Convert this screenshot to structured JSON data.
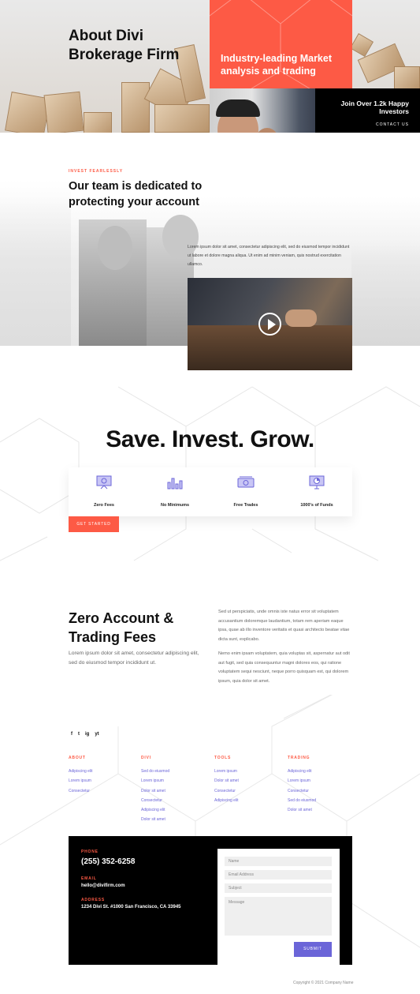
{
  "hero": {
    "title": "About Divi Brokerage Firm",
    "orange_text": "Industry-leading Market analysis and trading",
    "join_text": "Join Over 1.2k Happy Investors",
    "contact_label": "CONTACT US"
  },
  "team": {
    "kicker": "INVEST FEARLESSLY",
    "heading": "Our team is dedicated to protecting your account",
    "body": "Lorem ipsum dolor sit amet, consectetur adipiscing elit, sed do eiusmod tempor incididunt ut labore et dolore magna aliqua. Ut enim ad minim veniam, quis nostrud exercitation ullamco."
  },
  "grow": {
    "title": "Save. Invest. Grow.",
    "features": [
      {
        "label": "Zero Fees",
        "icon": "presentation-board-icon"
      },
      {
        "label": "No Minimums",
        "icon": "bar-chart-icon"
      },
      {
        "label": "Free Trades",
        "icon": "cash-icon"
      },
      {
        "label": "1000's of Funds",
        "icon": "monitor-chart-icon"
      }
    ],
    "cta": "GET STARTED"
  },
  "fees": {
    "heading": "Zero Account & Trading Fees",
    "body": "Lorem ipsum dolor sit amet, consectetur adipiscing elit, sed do eiusmod tempor incididunt ut.",
    "para1": "Sed ut perspiciatis, unde omnis iste natus error sit voluptatem accusantium doloremque laudantium, totam rem aperiam eaque ipsa, quae ab illo inventore veritatis et quasi architecto beatae vitae dicta sunt, explicabo.",
    "para2": "Nemo enim ipsam voluptatem, quia voluptas sit, aspernatur aut odit aut fugit, sed quia consequuntur magni dolores eos, qui ratione voluptatem sequi nesciunt, neque porro quisquam est, qui dolorem ipsum, quia dolor sit amet."
  },
  "footer": {
    "social": [
      "f",
      "t",
      "ig",
      "yt"
    ],
    "columns": [
      {
        "heading": "ABOUT",
        "links": [
          "Adipiscing elit",
          "Lorem ipsum",
          "Consectetur"
        ]
      },
      {
        "heading": "DIVI",
        "links": [
          "Sed do eiusmod",
          "Lorem ipsum",
          "Dolor sit amet",
          "Consectetur",
          "Adipiscing elit",
          "Dolor sit amet"
        ]
      },
      {
        "heading": "TOOLS",
        "links": [
          "Lorem ipsum",
          "Dolor sit amet",
          "Consectetur",
          "Adipiscing elit"
        ]
      },
      {
        "heading": "TRADING",
        "links": [
          "Adipiscing elit",
          "Lorem ipsum",
          "Consectetur",
          "Sed do eiusmod",
          "Dolor sit amet"
        ]
      }
    ]
  },
  "contact": {
    "phone_label": "PHONE",
    "phone": "(255) 352-6258",
    "email_label": "EMAIL",
    "email": "hello@divifirm.com",
    "address_label": "ADDRESS",
    "address": "1234 Divi St. #1000 San Francisco, CA 33945",
    "form": {
      "name": "Name",
      "email": "Email Address",
      "subject": "Subject",
      "message": "Message",
      "submit": "SUBMIT"
    }
  },
  "copyright": "Copyright © 2021 Company Name",
  "colors": {
    "accent": "#fd5a45",
    "purple": "#6b65d8",
    "dark": "#000000"
  }
}
